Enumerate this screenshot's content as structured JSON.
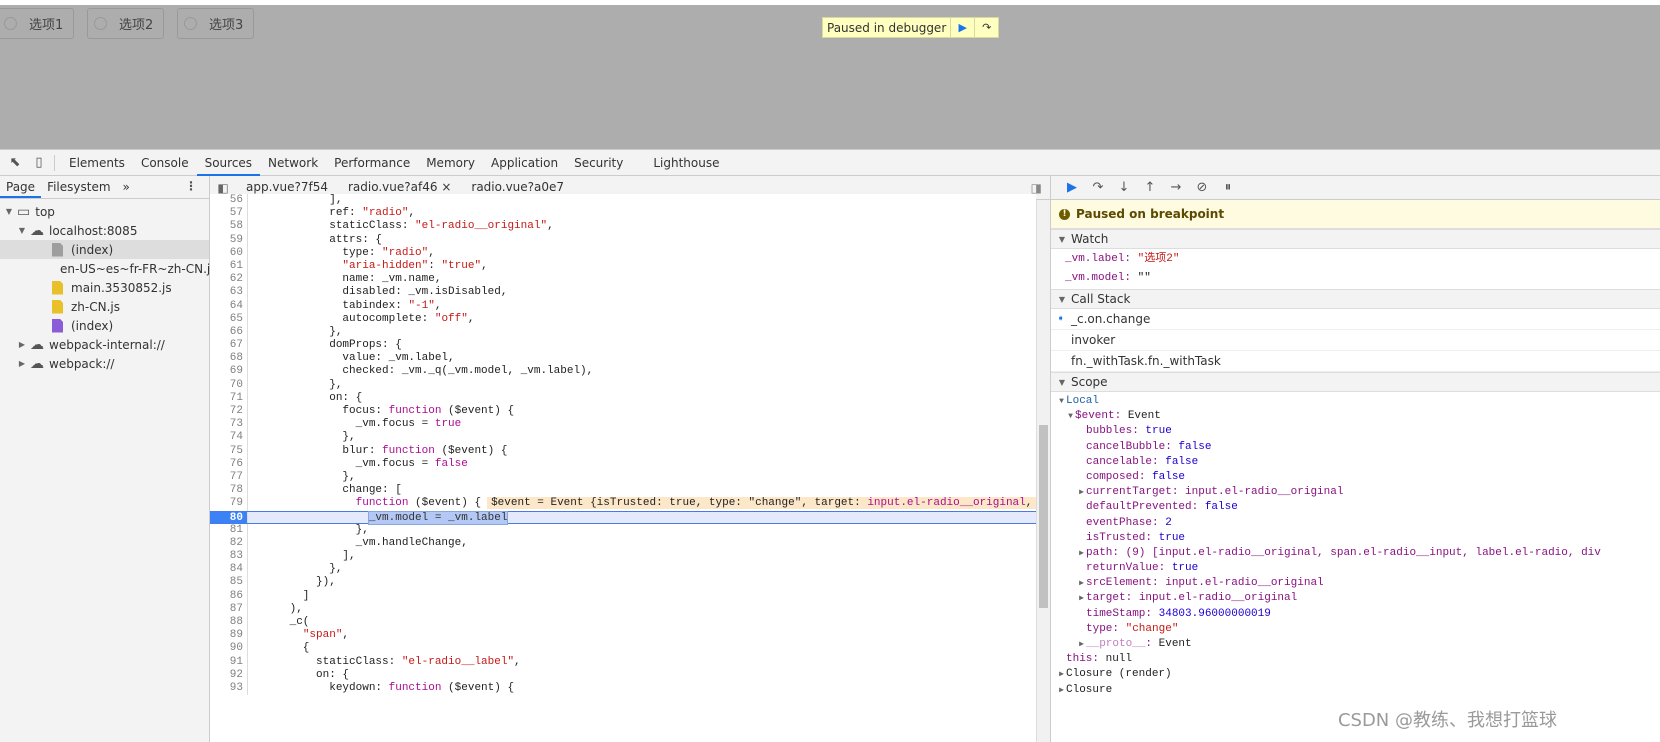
{
  "page": {
    "radios": [
      "选项1",
      "选项2",
      "选项3"
    ],
    "paused_pill": "Paused in debugger"
  },
  "devtools": {
    "panel_tabs": [
      "Elements",
      "Console",
      "Sources",
      "Network",
      "Performance",
      "Memory",
      "Application",
      "Security",
      "Lighthouse"
    ],
    "active_panel": "Sources"
  },
  "navigator": {
    "tabs": [
      "Page",
      "Filesystem"
    ],
    "more": "»",
    "tree": [
      {
        "label": "top",
        "depth": 0,
        "type": "frame",
        "open": true
      },
      {
        "label": "localhost:8085",
        "depth": 1,
        "type": "cloud",
        "open": true
      },
      {
        "label": "(index)",
        "depth": 2,
        "type": "file-gray",
        "selected": true
      },
      {
        "label": "en-US~es~fr-FR~zh-CN.js",
        "depth": 2,
        "type": "file-js"
      },
      {
        "label": "main.3530852.js",
        "depth": 2,
        "type": "file-js"
      },
      {
        "label": "zh-CN.js",
        "depth": 2,
        "type": "file-js"
      },
      {
        "label": "(index)",
        "depth": 2,
        "type": "file-purple"
      },
      {
        "label": "webpack-internal://",
        "depth": 1,
        "type": "cloud",
        "open": false
      },
      {
        "label": "webpack://",
        "depth": 1,
        "type": "cloud",
        "open": false
      }
    ]
  },
  "editor": {
    "tabs": [
      "app.vue?7f54",
      "radio.vue?af46",
      "radio.vue?a0e7"
    ],
    "active_tab": 1,
    "close": "×",
    "breakpoint_line": 80,
    "lines": [
      {
        "n": 56,
        "s": [
          [
            "p",
            "            ],"
          ]
        ]
      },
      {
        "n": 57,
        "s": [
          [
            "p",
            "            ref: "
          ],
          [
            "s",
            "\"radio\""
          ],
          [
            "p",
            ","
          ]
        ]
      },
      {
        "n": 58,
        "s": [
          [
            "p",
            "            staticClass: "
          ],
          [
            "s",
            "\"el-radio__original\""
          ],
          [
            "p",
            ","
          ]
        ]
      },
      {
        "n": 59,
        "s": [
          [
            "p",
            "            attrs: {"
          ]
        ]
      },
      {
        "n": 60,
        "s": [
          [
            "p",
            "              type: "
          ],
          [
            "s",
            "\"radio\""
          ],
          [
            "p",
            ","
          ]
        ]
      },
      {
        "n": 61,
        "s": [
          [
            "p",
            "              "
          ],
          [
            "s",
            "\"aria-hidden\""
          ],
          [
            "p",
            ": "
          ],
          [
            "s",
            "\"true\""
          ],
          [
            "p",
            ","
          ]
        ]
      },
      {
        "n": 62,
        "s": [
          [
            "p",
            "              name: _vm.name,"
          ]
        ]
      },
      {
        "n": 63,
        "s": [
          [
            "p",
            "              disabled: _vm.isDisabled,"
          ]
        ]
      },
      {
        "n": 64,
        "s": [
          [
            "p",
            "              tabindex: "
          ],
          [
            "s",
            "\"-1\""
          ],
          [
            "p",
            ","
          ]
        ]
      },
      {
        "n": 65,
        "s": [
          [
            "p",
            "              autocomplete: "
          ],
          [
            "s",
            "\"off\""
          ],
          [
            "p",
            ","
          ]
        ]
      },
      {
        "n": 66,
        "s": [
          [
            "p",
            "            },"
          ]
        ]
      },
      {
        "n": 67,
        "s": [
          [
            "p",
            "            domProps: {"
          ]
        ]
      },
      {
        "n": 68,
        "s": [
          [
            "p",
            "              value: _vm.label,"
          ]
        ]
      },
      {
        "n": 69,
        "s": [
          [
            "p",
            "              checked: _vm._q(_vm.model, _vm.label),"
          ]
        ]
      },
      {
        "n": 70,
        "s": [
          [
            "p",
            "            },"
          ]
        ]
      },
      {
        "n": 71,
        "s": [
          [
            "p",
            "            on: {"
          ]
        ]
      },
      {
        "n": 72,
        "s": [
          [
            "p",
            "              focus: "
          ],
          [
            "k",
            "function"
          ],
          [
            "p",
            " ($event) {"
          ]
        ]
      },
      {
        "n": 73,
        "s": [
          [
            "p",
            "                _vm.focus = "
          ],
          [
            "k",
            "true"
          ]
        ]
      },
      {
        "n": 74,
        "s": [
          [
            "p",
            "              },"
          ]
        ]
      },
      {
        "n": 75,
        "s": [
          [
            "p",
            "              blur: "
          ],
          [
            "k",
            "function"
          ],
          [
            "p",
            " ($event) {"
          ]
        ]
      },
      {
        "n": 76,
        "s": [
          [
            "p",
            "                _vm.focus = "
          ],
          [
            "k",
            "false"
          ]
        ]
      },
      {
        "n": 77,
        "s": [
          [
            "p",
            "              },"
          ]
        ]
      },
      {
        "n": 78,
        "s": [
          [
            "p",
            "              change: ["
          ]
        ]
      },
      {
        "n": 79,
        "s": [
          [
            "p",
            "                "
          ],
          [
            "k",
            "function"
          ],
          [
            "p",
            " ($event) {"
          ]
        ],
        "inline": [
          [
            "p",
            "$event = Event {isTrusted: true, type: \"change\", target: "
          ],
          [
            "k",
            "input.el-radio__original"
          ],
          [
            "p",
            ", currentTarget: input.el-radio__original"
          ]
        ]
      },
      {
        "n": 80,
        "s": [
          [
            "p",
            "                  "
          ],
          [
            "h",
            "_vm.model = _vm.label"
          ]
        ]
      },
      {
        "n": 81,
        "s": [
          [
            "p",
            "                },"
          ]
        ]
      },
      {
        "n": 82,
        "s": [
          [
            "p",
            "                _vm.handleChange,"
          ]
        ]
      },
      {
        "n": 83,
        "s": [
          [
            "p",
            "              ],"
          ]
        ]
      },
      {
        "n": 84,
        "s": [
          [
            "p",
            "            },"
          ]
        ]
      },
      {
        "n": 85,
        "s": [
          [
            "p",
            "          }),"
          ]
        ]
      },
      {
        "n": 86,
        "s": [
          [
            "p",
            "        ]"
          ]
        ]
      },
      {
        "n": 87,
        "s": [
          [
            "p",
            "      ),"
          ]
        ]
      },
      {
        "n": 88,
        "s": [
          [
            "p",
            "      _c("
          ]
        ]
      },
      {
        "n": 89,
        "s": [
          [
            "p",
            "        "
          ],
          [
            "s",
            "\"span\""
          ],
          [
            "p",
            ","
          ]
        ]
      },
      {
        "n": 90,
        "s": [
          [
            "p",
            "        {"
          ]
        ]
      },
      {
        "n": 91,
        "s": [
          [
            "p",
            "          staticClass: "
          ],
          [
            "s",
            "\"el-radio__label\""
          ],
          [
            "p",
            ","
          ]
        ]
      },
      {
        "n": 92,
        "s": [
          [
            "p",
            "          on: {"
          ]
        ]
      },
      {
        "n": 93,
        "s": [
          [
            "p",
            "            keydown: "
          ],
          [
            "k",
            "function"
          ],
          [
            "p",
            " ($event) {"
          ]
        ]
      }
    ]
  },
  "debugger": {
    "banner": "Paused on breakpoint",
    "watch_title": "Watch",
    "watch": [
      {
        "expr": "_vm.label",
        "value": "\"选项2\""
      },
      {
        "expr": "_vm.model",
        "value": "\"\""
      }
    ],
    "callstack_title": "Call Stack",
    "callstack": [
      "_c.on.change",
      "invoker",
      "fn._withTask.fn._withTask"
    ],
    "scope_title": "Scope",
    "scope": [
      {
        "d": 0,
        "tri": "open",
        "key": "Local",
        "kc": "vlocal"
      },
      {
        "d": 1,
        "tri": "open",
        "key": "$event",
        "val": "Event",
        "vc": "vobj"
      },
      {
        "d": 2,
        "key": "bubbles",
        "val": "true",
        "vc": "vnum"
      },
      {
        "d": 2,
        "key": "cancelBubble",
        "val": "false",
        "vc": "vnum"
      },
      {
        "d": 2,
        "key": "cancelable",
        "val": "false",
        "vc": "vnum"
      },
      {
        "d": 2,
        "key": "composed",
        "val": "false",
        "vc": "vnum"
      },
      {
        "d": 2,
        "tri": "closed",
        "key": "currentTarget",
        "val": "input.el-radio__original",
        "vc": "vel"
      },
      {
        "d": 2,
        "key": "defaultPrevented",
        "val": "false",
        "vc": "vnum"
      },
      {
        "d": 2,
        "key": "eventPhase",
        "val": "2",
        "vc": "vnum"
      },
      {
        "d": 2,
        "key": "isTrusted",
        "val": "true",
        "vc": "vnum"
      },
      {
        "d": 2,
        "tri": "closed",
        "key": "path",
        "val": "(9) [input.el-radio__original, span.el-radio__input, label.el-radio, div",
        "vc": "vel"
      },
      {
        "d": 2,
        "key": "returnValue",
        "val": "true",
        "vc": "vnum"
      },
      {
        "d": 2,
        "tri": "closed",
        "key": "srcElement",
        "val": "input.el-radio__original",
        "vc": "vel"
      },
      {
        "d": 2,
        "tri": "closed",
        "key": "target",
        "val": "input.el-radio__original",
        "vc": "vel"
      },
      {
        "d": 2,
        "key": "timeStamp",
        "val": "34803.96000000019",
        "vc": "vnum"
      },
      {
        "d": 2,
        "key": "type",
        "val": "\"change\"",
        "vc": "vstr"
      },
      {
        "d": 2,
        "tri": "closed",
        "key": "__proto__",
        "val": "Event",
        "vc": "vobj",
        "dim": true
      },
      {
        "d": 1,
        "key": "this",
        "val": "null",
        "vc": "vobj"
      },
      {
        "d": 0,
        "tri": "closed",
        "key": "Closure (render)",
        "kc": "vobj"
      },
      {
        "d": 0,
        "tri": "closed",
        "key": "Closure",
        "kc": "vobj"
      }
    ]
  },
  "watermark": "CSDN @教练、我想打篮球"
}
